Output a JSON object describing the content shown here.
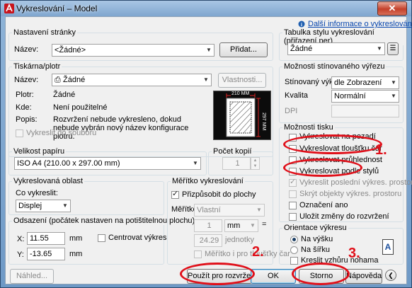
{
  "window": {
    "title": "Vykreslování – Model",
    "close": "✕"
  },
  "header": {
    "info_link": "Další informace o vykreslování"
  },
  "page_setup": {
    "group": "Nastavení stránky",
    "name_label": "Název:",
    "name_value": "<Žádné>",
    "add_button": "Přidat..."
  },
  "printer": {
    "group": "Tiskárna/plotr",
    "name_label": "Název:",
    "name_value": "Žádné",
    "properties_button": "Vlastnosti...",
    "plotter_label": "Plotr:",
    "plotter_value": "Žádné",
    "where_label": "Kde:",
    "where_value": "Není použitelné",
    "desc_label": "Popis:",
    "desc_value": "Rozvržení nebude vykresleno, dokud nebude vybrán nový název konfigurace plotru.",
    "plot_to_file": "Vykreslit do souboru",
    "preview_width": "210 MM",
    "preview_height": "297 MM"
  },
  "paper_size": {
    "group": "Velikost papíru",
    "value": "ISO A4 (210.00 x 297.00 mm)"
  },
  "copies": {
    "group": "Počet kopií",
    "value": "1"
  },
  "plot_area": {
    "group": "Vykreslovaná oblast",
    "what_label": "Co vykreslit:",
    "what_value": "Displej"
  },
  "plot_offset": {
    "group": "Odsazení (počátek nastaven na potištitelnou plochu)",
    "x_label": "X:",
    "x_value": "11.55",
    "y_label": "Y:",
    "y_value": "-13.65",
    "unit": "mm",
    "center": "Centrovat výkres"
  },
  "plot_scale": {
    "group": "Měřítko vykreslování",
    "fit": "Přizpůsobit do plochy",
    "scale_label": "Měřítko:",
    "scale_value": "Vlastní",
    "value1": "1",
    "unit": "mm",
    "equals": "=",
    "value2": "24.29",
    "unit2": "jednotky",
    "lineweights": "Měřítko i pro tloušťky čar"
  },
  "plot_style": {
    "group": "Tabulka stylu vykreslování (přiřazení per)",
    "value": "Žádné"
  },
  "shaded": {
    "group": "Možnosti stínovaného výřezu",
    "shade_label": "Stínovaný výkr.",
    "shade_value": "dle Zobrazení",
    "quality_label": "Kvalita",
    "quality_value": "Normální",
    "dpi_label": "DPI"
  },
  "plot_options": {
    "group": "Možnosti tisku",
    "items": [
      "Vykreslovat na pozadí",
      "Vykreslovat tloušťku čar",
      "Vykreslovat průhlednost",
      "Vykreslovat podle stylů",
      "Vykreslit poslední výkres. prostoru",
      "Skrýt objekty výkres. prostoru",
      "Označení ano",
      "Uložit změny do rozvržení"
    ]
  },
  "orientation": {
    "group": "Orientace výkresu",
    "portrait": "Na výšku",
    "landscape": "Na šířku",
    "upside": "Kreslit vzhůru nohama",
    "icon_letter": "A"
  },
  "buttons": {
    "preview": "Náhled...",
    "apply": "Použít pro rozvržení",
    "ok": "OK",
    "cancel": "Storno",
    "help": "Nápověda"
  },
  "annotations": {
    "n1": "1.",
    "n2": "2.",
    "n3": "3."
  },
  "colors": {
    "annotation": "#e0101a",
    "titlebar": "#7fa6cf"
  }
}
